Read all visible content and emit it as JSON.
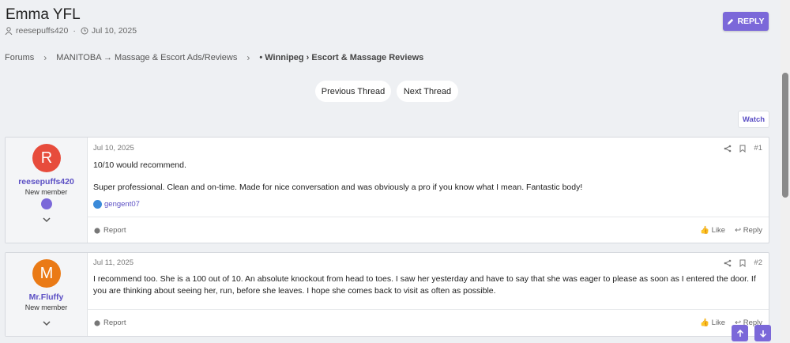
{
  "thread": {
    "title": "Emma YFL",
    "author": "reesepuffs420",
    "date": "Jul 10, 2025",
    "reply_label": "REPLY"
  },
  "breadcrumb": [
    "Forums",
    "MANITOBA → Massage & Escort Ads/Reviews",
    "• Winnipeg › Escort & Massage Reviews"
  ],
  "nav": {
    "prev": "Previous Thread",
    "next": "Next Thread",
    "watch": "Watch"
  },
  "posts": [
    {
      "avatar_letter": "R",
      "avatar_color": "#e74c3c",
      "username": "reesepuffs420",
      "user_title": "New member",
      "date": "Jul 10, 2025",
      "number": "#1",
      "lines": [
        "10/10 would recommend.",
        "Super professional. Clean and on-time. Made for nice conversation and was obviously a pro if you know what I mean. Fantastic body!"
      ],
      "liked_by": "gengent07"
    },
    {
      "avatar_letter": "M",
      "avatar_color": "#ea7a16",
      "username": "Mr.Fluffy",
      "user_title": "New member",
      "date": "Jul 11, 2025",
      "number": "#2",
      "lines": [
        "I recommend too. She is a 100 out of 10. An absolute knockout from head to toes. I saw her yesterday and have to say that she was eager to please as soon as I entered the door. If you are thinking about seeing her, run, before she leaves. I hope she comes back to visit as often as possible."
      ]
    }
  ],
  "post_actions": {
    "report": "Report",
    "like": "Like",
    "reply": "Reply"
  },
  "colors": {
    "accent": "#7b68d9",
    "link": "#5b4fc4"
  }
}
